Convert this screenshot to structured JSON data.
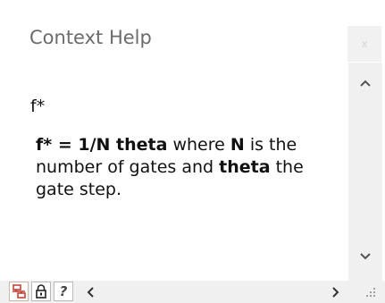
{
  "window": {
    "title": "Context Help",
    "close_label": "x"
  },
  "help": {
    "topic": "f*",
    "part1": "f* = 1/N theta",
    "part2": " where ",
    "part3": "N",
    "part4": " is the number of gates and ",
    "part5": "theta",
    "part6": " the gate step."
  },
  "toolbar": {
    "buttons": [
      {
        "icon": "show-hierarchy-icon"
      },
      {
        "icon": "lock-icon"
      },
      {
        "icon": "detailed-help-icon",
        "glyph": "?"
      }
    ]
  },
  "scrollbar": {
    "up_icon": "chevron-up-icon",
    "down_icon": "chevron-down-icon",
    "left_icon": "chevron-left-icon",
    "right_icon": "chevron-right-icon"
  },
  "colors": {
    "title_text": "#6b6b6b",
    "body_text": "#111111",
    "chrome": "#f0f0f0",
    "hierarchy_icon": "#c0392b"
  }
}
